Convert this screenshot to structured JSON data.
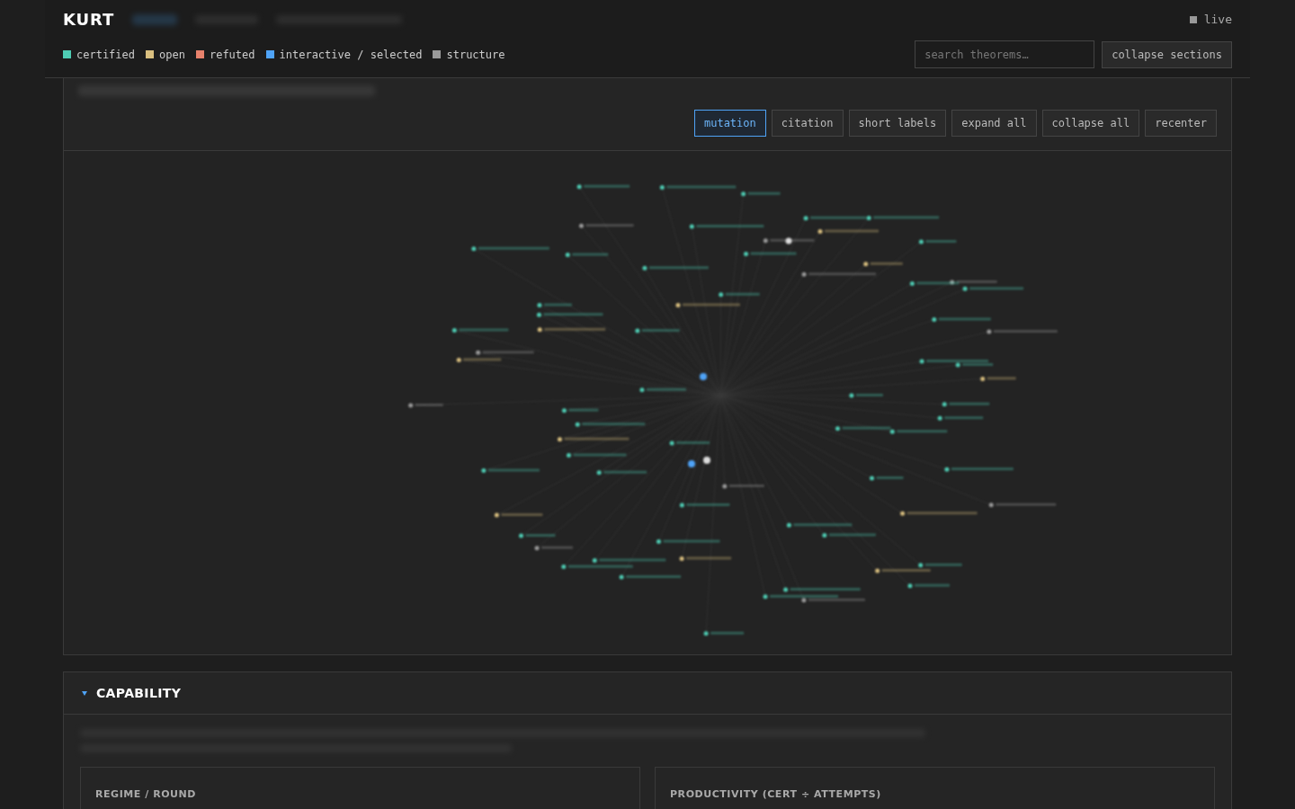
{
  "header": {
    "title": "KURT",
    "status": "live"
  },
  "legend": [
    {
      "label": "certified",
      "color": "#4ecdb4"
    },
    {
      "label": "open",
      "color": "#d9bf7f"
    },
    {
      "label": "refuted",
      "color": "#e8826c"
    },
    {
      "label": "interactive / selected",
      "color": "#4fa3f7"
    },
    {
      "label": "structure",
      "color": "#9a9a9a"
    }
  ],
  "search": {
    "placeholder": "search theorems…"
  },
  "collapse_sections": "collapse sections",
  "graph_toolbar": [
    {
      "label": "mutation",
      "selected": true
    },
    {
      "label": "citation",
      "selected": false
    },
    {
      "label": "short labels",
      "selected": false
    },
    {
      "label": "expand all",
      "selected": false
    },
    {
      "label": "collapse all",
      "selected": false
    },
    {
      "label": "recenter",
      "selected": false
    }
  ],
  "section": {
    "title": "CAPABILITY",
    "expanded": true,
    "cards": [
      {
        "title": "REGIME / ROUND"
      },
      {
        "title": "PRODUCTIVITY (CERT ÷ ATTEMPTS)"
      }
    ]
  }
}
